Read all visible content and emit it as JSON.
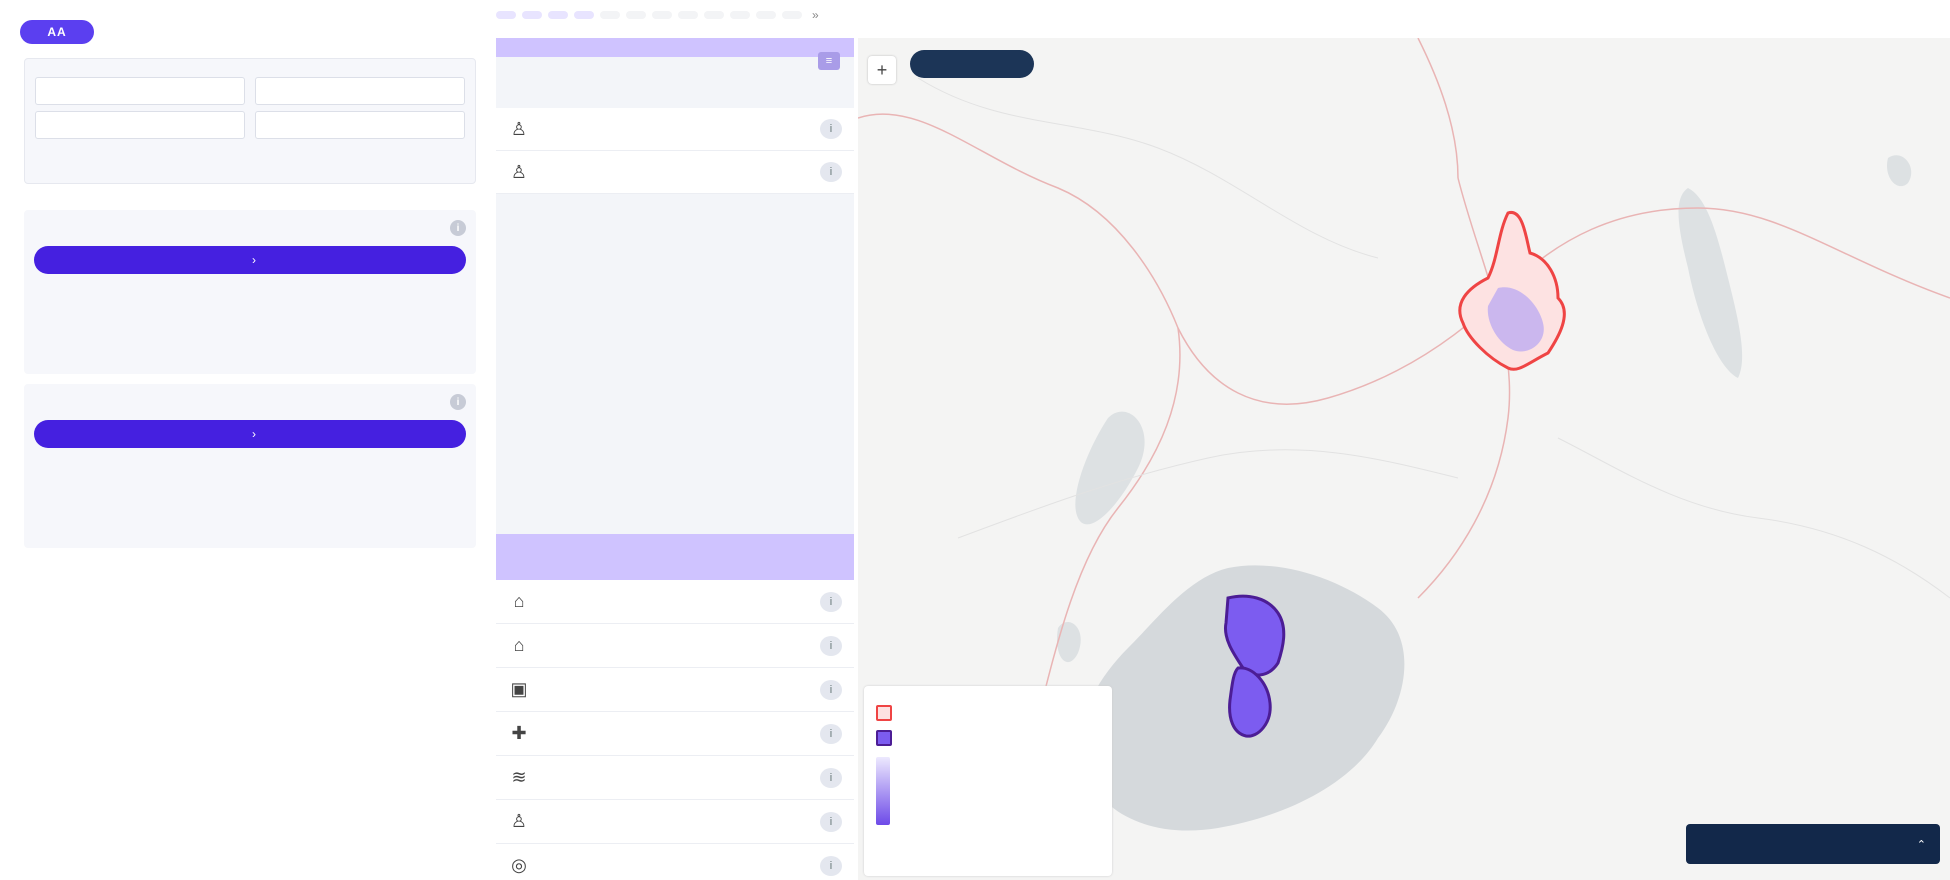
{
  "brand": {
    "logo": "AA",
    "line1": "",
    "line2": ""
  },
  "date_tabs": [
    {
      "label": "",
      "active": true
    },
    {
      "label": "",
      "active": true
    },
    {
      "label": "",
      "active": true
    },
    {
      "label": "",
      "active": true
    },
    {
      "label": "",
      "active": false
    },
    {
      "label": "",
      "active": false
    },
    {
      "label": "",
      "active": false
    },
    {
      "label": "",
      "active": false
    },
    {
      "label": "",
      "active": false
    },
    {
      "label": "",
      "active": false
    },
    {
      "label": "",
      "active": false
    },
    {
      "label": "",
      "active": false
    }
  ],
  "date_more": "»",
  "info": {
    "text": "",
    "buttons": [
      "",
      "",
      "",
      ""
    ]
  },
  "triggers": [
    {
      "title": "",
      "line1_label": "",
      "line1_value": "",
      "line2_label": "",
      "line2_value": "",
      "action": "",
      "note": ""
    },
    {
      "title": "",
      "line1_label": "",
      "line1_value": "",
      "line2_label": "",
      "line2_value": "",
      "action": "",
      "note": ""
    }
  ],
  "exposure_panel": {
    "title": "",
    "subtitle": "",
    "rows": [
      {
        "icon": "person-icon",
        "label": "",
        "value": ""
      },
      {
        "icon": "person-icon",
        "label": "",
        "value": ""
      }
    ]
  },
  "sector_panel": {
    "title": "",
    "col_left": "",
    "col_right": "",
    "rows": [
      {
        "icon": "shelter-icon",
        "label": "",
        "value": ""
      },
      {
        "icon": "school-icon",
        "label": "",
        "value": ""
      },
      {
        "icon": "building-icon",
        "label": "",
        "value": ""
      },
      {
        "icon": "health-icon",
        "label": "",
        "value": ""
      },
      {
        "icon": "water-icon",
        "label": "",
        "value": ""
      },
      {
        "icon": "person-icon",
        "label": "",
        "value": ""
      },
      {
        "icon": "other-icon",
        "label": "",
        "value": ""
      }
    ]
  },
  "map": {
    "zoom_label": "+",
    "pill_label": "",
    "legend": {
      "title": "",
      "item1": "",
      "item2": "",
      "scale_title": "",
      "scale_ticks": [
        "",
        "",
        "",
        "",
        ""
      ]
    },
    "layers_label": "",
    "layers_icon": "chevron-icon"
  },
  "colors": {
    "accent": "#4520e0",
    "header_purple": "#cfc3ff",
    "trigger_red": "#e04444",
    "map_navy": "#12284a"
  }
}
